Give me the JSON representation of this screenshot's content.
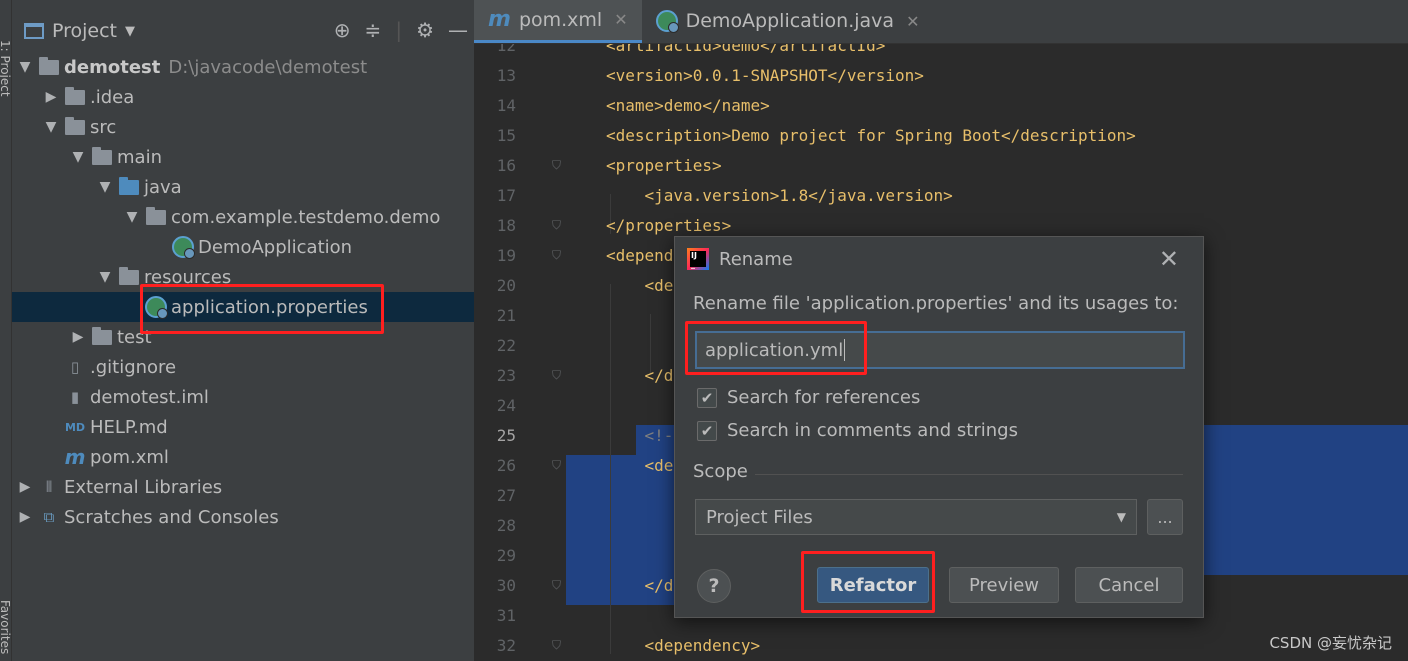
{
  "side_strip": {
    "top_label": "1: Project",
    "bottom_label": "Favorites"
  },
  "project_panel": {
    "title": "Project",
    "tree": [
      {
        "label": "demotest",
        "path": "D:\\javacode\\demotest"
      },
      {
        "label": ".idea"
      },
      {
        "label": "src"
      },
      {
        "label": "main"
      },
      {
        "label": "java"
      },
      {
        "label": "com.example.testdemo.demo"
      },
      {
        "label": "DemoApplication"
      },
      {
        "label": "resources"
      },
      {
        "label": "application.properties"
      },
      {
        "label": "test"
      },
      {
        "label": ".gitignore"
      },
      {
        "label": "demotest.iml"
      },
      {
        "label": "HELP.md"
      },
      {
        "label": "pom.xml"
      },
      {
        "label": "External Libraries"
      },
      {
        "label": "Scratches and Consoles"
      }
    ]
  },
  "editor": {
    "tabs": [
      {
        "label": "pom.xml"
      },
      {
        "label": "DemoApplication.java"
      }
    ],
    "lines": [
      {
        "num": "12",
        "text": "<artifactId>demo</artifactId>"
      },
      {
        "num": "13",
        "text": "<version>0.0.1-SNAPSHOT</version>"
      },
      {
        "num": "14",
        "text": "<name>demo</name>"
      },
      {
        "num": "15",
        "text": "<description>Demo project for Spring Boot</description>"
      },
      {
        "num": "16",
        "text": "<properties>"
      },
      {
        "num": "17",
        "text": "    <java.version>1.8</java.version>"
      },
      {
        "num": "18",
        "text": "</properties>"
      },
      {
        "num": "19",
        "text": "<depend"
      },
      {
        "num": "20",
        "text": "    <de"
      },
      {
        "num": "21",
        "text": ""
      },
      {
        "num": "22",
        "text": ""
      },
      {
        "num": "23",
        "text": "    </d"
      },
      {
        "num": "24",
        "text": ""
      },
      {
        "num": "25",
        "text": "    <!-"
      },
      {
        "num": "26",
        "text": "    <de"
      },
      {
        "num": "27",
        "text": ""
      },
      {
        "num": "28",
        "text": ""
      },
      {
        "num": "29",
        "text": ""
      },
      {
        "num": "30",
        "text": "    </d"
      },
      {
        "num": "31",
        "text": ""
      },
      {
        "num": "32",
        "text": "    <dependency>"
      }
    ]
  },
  "dialog": {
    "title": "Rename",
    "prompt": "Rename file 'application.properties' and its usages to:",
    "input_value": "application.yml",
    "check_references": "Search for references",
    "check_comments": "Search in comments and strings",
    "scope_label": "Scope",
    "scope_value": "Project Files",
    "ellipsis": "...",
    "help": "?",
    "refactor": "Refactor",
    "preview": "Preview",
    "cancel": "Cancel"
  },
  "watermark": "CSDN @妄忧杂记",
  "colors": {
    "highlight": "#ff1f1f",
    "selection": "#214283",
    "primary_button": "#365880"
  }
}
